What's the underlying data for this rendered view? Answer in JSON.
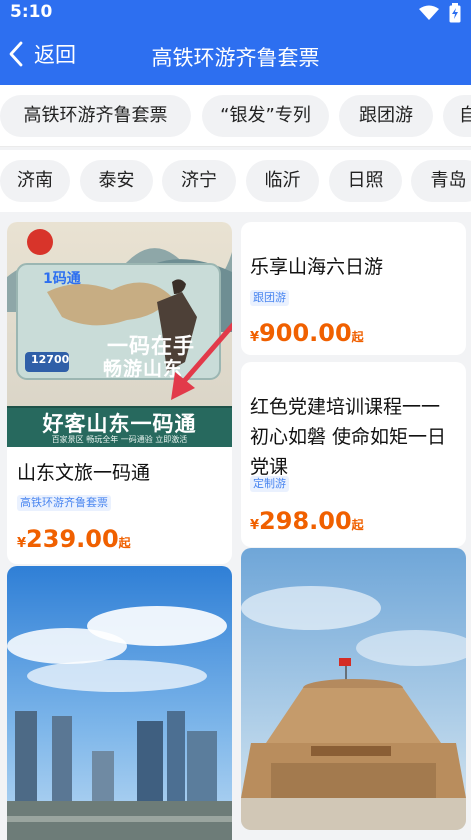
{
  "status": {
    "time": "5:10"
  },
  "nav": {
    "back_label": "返回",
    "title": "高铁环游齐鲁套票"
  },
  "categories": [
    "高铁环游齐鲁套票",
    "“银发”专列",
    "跟团游",
    "自"
  ],
  "cities": [
    "济南",
    "泰安",
    "济宁",
    "临沂",
    "日照",
    "青岛"
  ],
  "cards": [
    {
      "image_text_main": "好客山东一码通",
      "image_text_sub": "百家景区  畅玩全年  一码通验  立即激活",
      "image_card_brand": "1码通",
      "image_card_slogan_1": "一码在手",
      "image_card_slogan_2": "畅游山东",
      "image_card_price": "12700",
      "title": "山东文旅一码通",
      "tag": "高铁环游齐鲁套票",
      "price_currency": "¥",
      "price_value": "239.00",
      "price_suffix": "起"
    },
    {
      "title": "乐享山海六日游",
      "tag": "跟团游",
      "price_currency": "¥",
      "price_value": "900.00",
      "price_suffix": "起"
    },
    {
      "title": "红色党建培训课程一一初心如磐 使命如矩一日党课",
      "tag": "定制游",
      "price_currency": "¥",
      "price_value": "298.00",
      "price_suffix": "起"
    }
  ],
  "photo_cards": [
    {
      "scene": "city-skyline"
    },
    {
      "scene": "memorial-building"
    }
  ],
  "colors": {
    "header": "#2d6ff0",
    "price": "#f06000",
    "tag": "#4a86f0"
  }
}
